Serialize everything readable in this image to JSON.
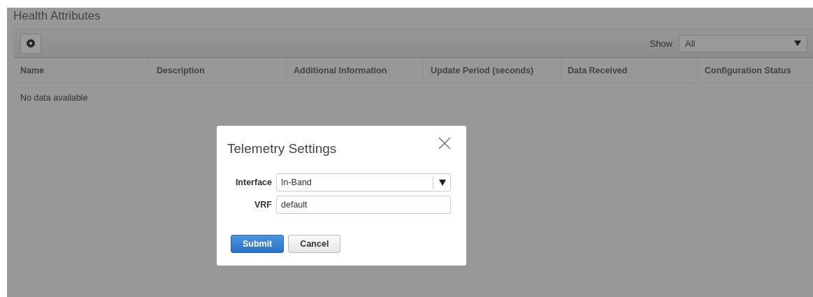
{
  "page": {
    "title": "Health Attributes"
  },
  "toolbar": {
    "show_label": "Show",
    "show_value": "All"
  },
  "table": {
    "columns": [
      "Name",
      "Description",
      "Additional Information",
      "Update Period (seconds)",
      "Data Received",
      "Configuration Status"
    ],
    "empty_text": "No data available"
  },
  "dialog": {
    "title": "Telemetry Settings",
    "fields": [
      {
        "label": "Interface",
        "kind": "select",
        "value": "In-Band"
      },
      {
        "label": "VRF",
        "kind": "text",
        "value": "default"
      }
    ],
    "buttons": [
      {
        "label": "Submit",
        "kind": "primary"
      },
      {
        "label": "Cancel",
        "kind": "default"
      }
    ]
  }
}
